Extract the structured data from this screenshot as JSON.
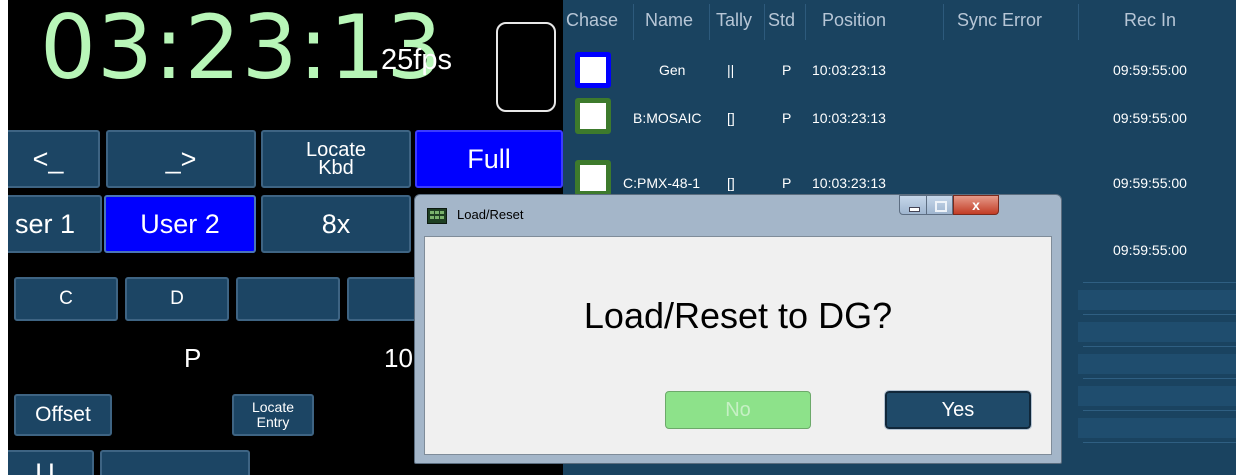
{
  "left": {
    "timecode": "03:23:13",
    "fps": "25fps",
    "buttons_row1": [
      "<_",
      "_>",
      "Locate\nKbd",
      "Full"
    ],
    "buttons_row2": [
      "ser 1",
      "User 2",
      "8x"
    ],
    "buttons_row3": [
      "C",
      "D"
    ],
    "std_value": "P",
    "pos_partial": "10",
    "offset_button": "Offset",
    "locate_entry_button": "Locate\nEntry",
    "partial_bottom": "U"
  },
  "table": {
    "headers": [
      "Chase",
      "Name",
      "Tally",
      "Std",
      "Position",
      "Sync Error",
      "Rec In"
    ],
    "rows": [
      {
        "name": "Gen",
        "tally": "||",
        "std": "P",
        "position": "10:03:23:13",
        "rec_in": "09:59:55:00",
        "chase_color": "#0000ff"
      },
      {
        "name": "B:MOSAIC",
        "tally": "[]",
        "std": "P",
        "position": "10:03:23:13",
        "rec_in": "09:59:55:00",
        "chase_color": "#3d7a2c"
      },
      {
        "name": "C:PMX-48-1",
        "tally": "[]",
        "std": "P",
        "position": "10:03:23:13",
        "rec_in": "09:59:55:00",
        "chase_color": "#3d7a2c"
      },
      {
        "name": "",
        "tally": "",
        "std": "",
        "position": "",
        "rec_in": "09:59:55:00",
        "chase_color": "#3d7a2c"
      }
    ]
  },
  "dialog": {
    "title": "Load/Reset",
    "message": "Load/Reset to DG?",
    "no_label": "No",
    "yes_label": "Yes",
    "close_glyph": "x"
  },
  "colors": {
    "timecode": "#b8f6b8",
    "panel_blue": "#1a4360",
    "button_blue": "#1c4564",
    "active_blue": "#0000ff",
    "no_green": "#8de28a"
  }
}
